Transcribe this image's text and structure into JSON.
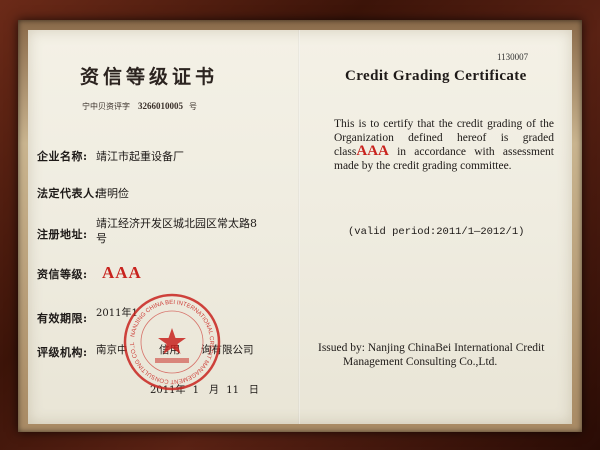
{
  "cn": {
    "title": "资信等级证书",
    "cert_prefix": "宁中贝资评字",
    "cert_number": "3266010005",
    "cert_suffix": "号",
    "company_label": "企业名称:",
    "company_value": "靖江市起重设备厂",
    "rep_label": "法定代表人:",
    "rep_value": "唐明俭",
    "address_label": "注册地址:",
    "address_line1": "靖江经济开发区城北园区常太路8",
    "address_line2": "号",
    "grade_label": "资信等级:",
    "grade_value": "AAA",
    "valid_label": "有效期限:",
    "valid_value": "2011年1",
    "org_label": "评级机构:",
    "org_value": "南京中　　　信用　　询有限公司",
    "date_year": "2011年",
    "date_month": "1　月",
    "date_day": "11　日"
  },
  "en": {
    "doc_number": "1130007",
    "title": "Credit Grading Certificate",
    "body_before": "This is to certify that the credit grading of the Organization defined hereof is graded class",
    "grade": "AAA",
    "body_after": "in accordance with assessment made by the credit grading committee.",
    "valid_period": "(valid period:2011/1—2012/1)",
    "issued_by_line1": "Issued by: Nanjing ChinaBei International Credit",
    "issued_by_line2": "Management Consulting Co.,Ltd."
  },
  "seal": {
    "ring_text": "NANJING CHINA BEI INTERNATIONAL CREDIT MANAGEMENT CONSULTING CO.,LTD",
    "color": "#c8231e"
  },
  "colors": {
    "accent_red": "#c8231e",
    "frame_brown": "#4a1a0c",
    "paper": "#f2efe4"
  }
}
